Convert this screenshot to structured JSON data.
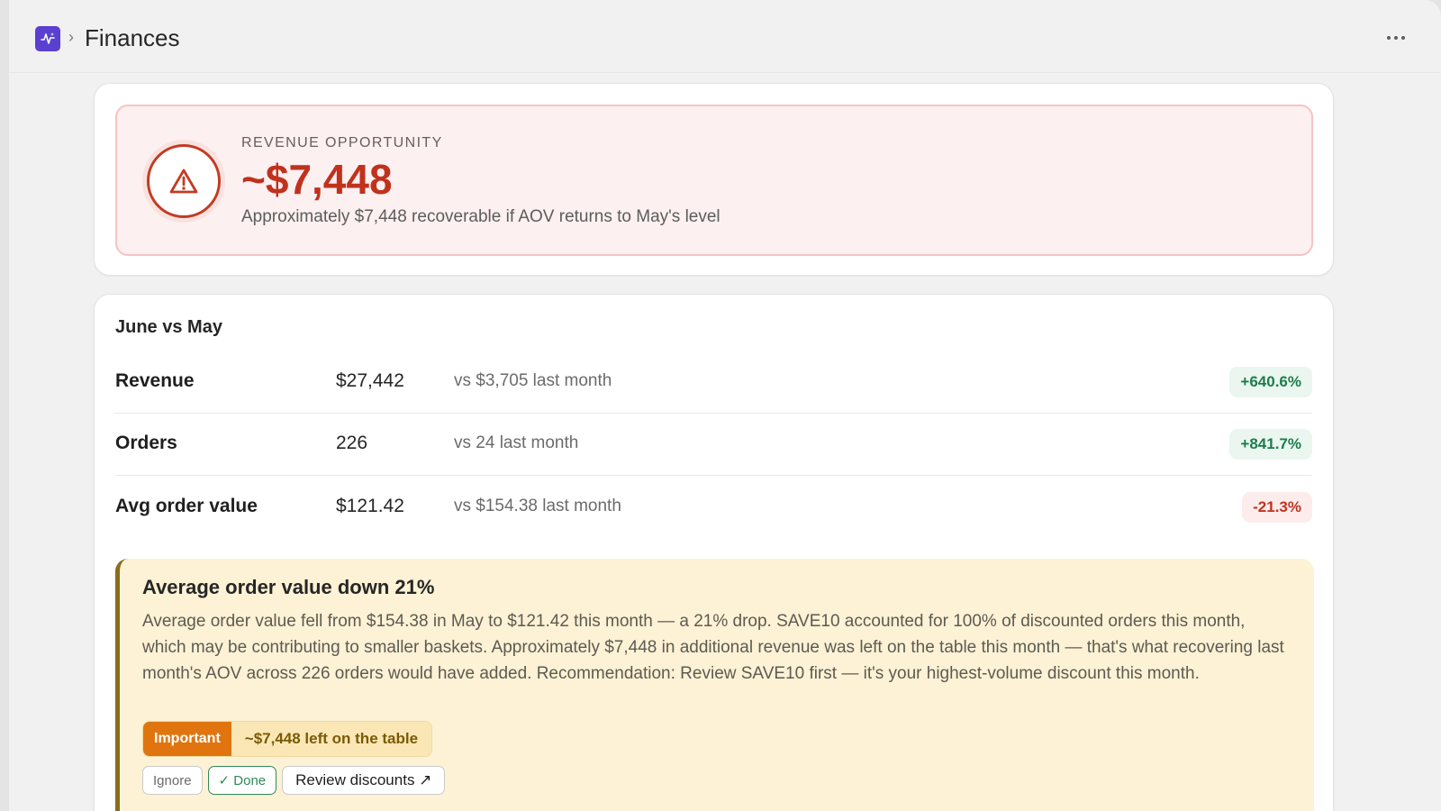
{
  "header": {
    "app_icon": "activity-icon",
    "separator": "›",
    "title": "Finances",
    "more_icon": "more-horizontal-icon"
  },
  "opportunity": {
    "eyebrow": "REVENUE OPPORTUNITY",
    "amount": "~$7,448",
    "description": "Approximately $7,448 recoverable if AOV returns to May's level",
    "icon": "warning-triangle-icon",
    "accent_color": "#c0321e"
  },
  "comparison": {
    "title": "June vs May",
    "metrics": [
      {
        "label": "Revenue",
        "value": "$27,442",
        "compare": "vs $3,705 last month",
        "change": "+640.6%",
        "trend": "up"
      },
      {
        "label": "Orders",
        "value": "226",
        "compare": "vs 24 last month",
        "change": "+841.7%",
        "trend": "up"
      },
      {
        "label": "Avg order value",
        "value": "$121.42",
        "compare": "vs $154.38 last month",
        "change": "-21.3%",
        "trend": "down"
      }
    ]
  },
  "insight": {
    "title": "Average order value down 21%",
    "body": "Average order value fell from $154.38 in May to $121.42 this month — a 21% drop. SAVE10 accounted for 100% of discounted orders this month, which may be contributing to smaller baskets. Approximately $7,448 in additional revenue was left on the table this month — that's what recovering last month's AOV across 226 orders would have added. Recommendation: Review SAVE10 first — it's your highest-volume discount this month.",
    "priority_label": "Important",
    "impact_label": "~$7,448 left on the table",
    "actions": {
      "ignore": "Ignore",
      "done": "✓ Done",
      "review": "Review discounts ↗"
    }
  }
}
